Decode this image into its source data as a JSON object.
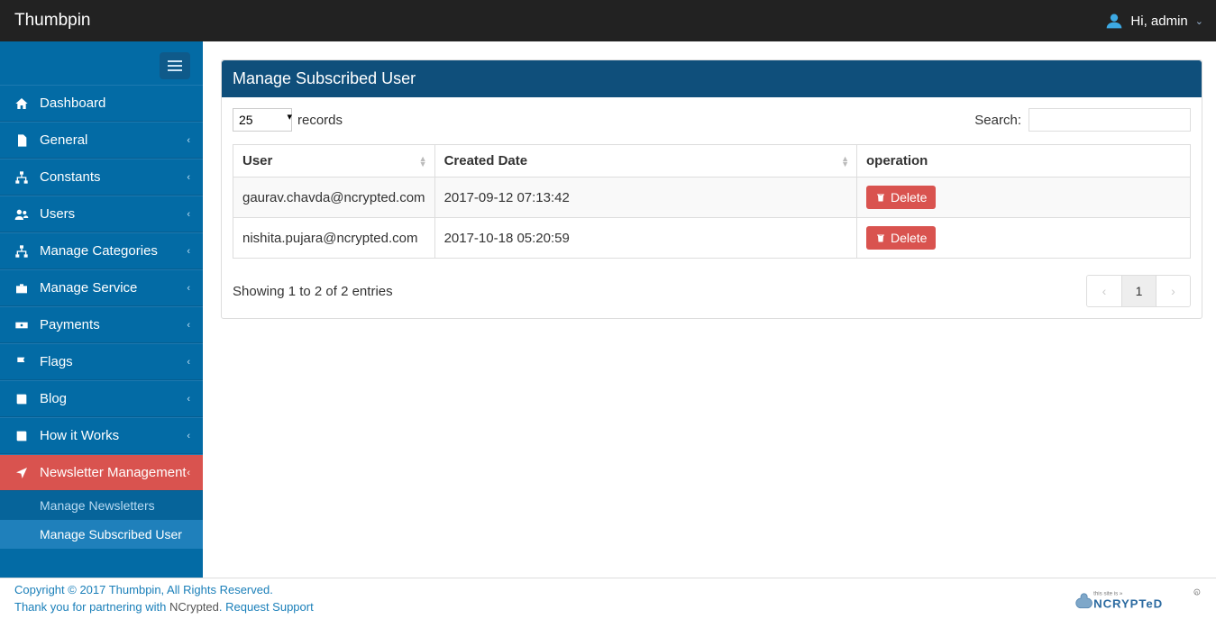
{
  "brand": "Thumbpin",
  "header": {
    "greeting": "Hi, admin"
  },
  "sidebar": {
    "items": [
      {
        "label": "Dashboard",
        "expandable": false
      },
      {
        "label": "General",
        "expandable": true
      },
      {
        "label": "Constants",
        "expandable": true
      },
      {
        "label": "Users",
        "expandable": true
      },
      {
        "label": "Manage Categories",
        "expandable": true
      },
      {
        "label": "Manage Service",
        "expandable": true
      },
      {
        "label": "Payments",
        "expandable": true
      },
      {
        "label": "Flags",
        "expandable": true
      },
      {
        "label": "Blog",
        "expandable": true
      },
      {
        "label": "How it Works",
        "expandable": true
      },
      {
        "label": "Newsletter Management",
        "expandable": true
      }
    ],
    "subitems": [
      {
        "label": "Manage Newsletters"
      },
      {
        "label": "Manage Subscribed User"
      }
    ]
  },
  "panel": {
    "title": "Manage Subscribed User",
    "records_value": "25",
    "records_label": "records",
    "search_label": "Search:",
    "columns": {
      "user": "User",
      "created": "Created Date",
      "operation": "operation"
    },
    "rows": [
      {
        "user": "gaurav.chavda@ncrypted.com",
        "created": "2017-09-12 07:13:42"
      },
      {
        "user": "nishita.pujara@ncrypted.com",
        "created": "2017-10-18 05:20:59"
      }
    ],
    "delete_label": "Delete",
    "showing": "Showing 1 to 2 of 2 entries",
    "page": "1"
  },
  "footer": {
    "line1": "Copyright © 2017 Thumbpin, All Rights Reserved.",
    "line2_a": "Thank you for partnering with ",
    "line2_link1": "NCrypted",
    "line2_b": ". ",
    "line2_link2": "Request Support",
    "logo_tag": "this site is »",
    "logo_text": "NCRYPTeD"
  }
}
